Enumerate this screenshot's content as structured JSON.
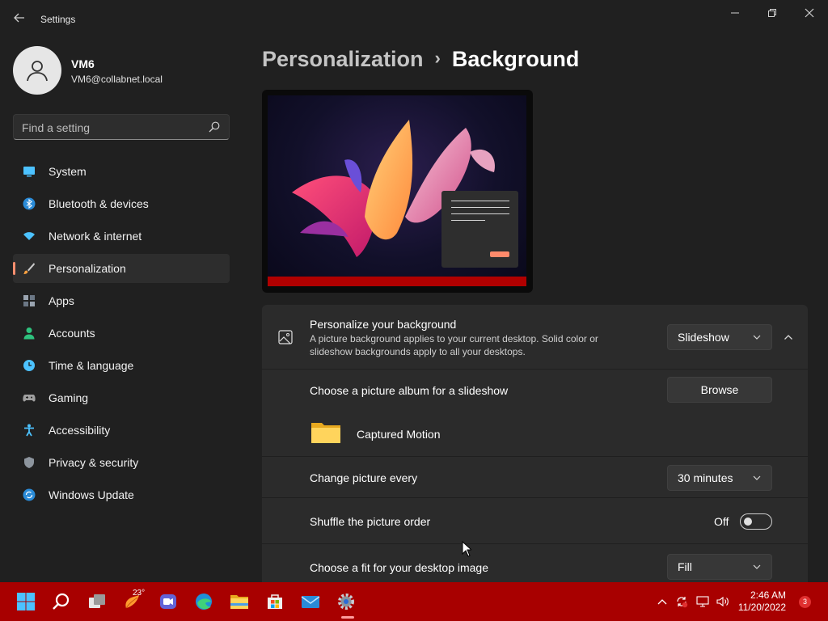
{
  "window": {
    "title": "Settings",
    "back_icon": "back-arrow-icon",
    "controls": {
      "minimize": "minimize-icon",
      "maximize": "restore-icon",
      "close": "close-icon"
    }
  },
  "user": {
    "name": "VM6",
    "email": "VM6@collabnet.local"
  },
  "search": {
    "placeholder": "Find a setting"
  },
  "sidebar": {
    "items": [
      {
        "label": "System",
        "icon": "monitor-icon",
        "color": "#4cc2ff"
      },
      {
        "label": "Bluetooth & devices",
        "icon": "bluetooth-icon",
        "color": "#4cc2ff"
      },
      {
        "label": "Network & internet",
        "icon": "wifi-icon",
        "color": "#4cc2ff"
      },
      {
        "label": "Personalization",
        "icon": "brush-icon",
        "color": "#f7a040",
        "active": true
      },
      {
        "label": "Apps",
        "icon": "apps-icon",
        "color": "#9aa4b0"
      },
      {
        "label": "Accounts",
        "icon": "person-icon",
        "color": "#2ec27e"
      },
      {
        "label": "Time & language",
        "icon": "clock-globe-icon",
        "color": "#4cc2ff"
      },
      {
        "label": "Gaming",
        "icon": "gamepad-icon",
        "color": "#a0a0a0"
      },
      {
        "label": "Accessibility",
        "icon": "accessibility-icon",
        "color": "#4cc2ff"
      },
      {
        "label": "Privacy & security",
        "icon": "shield-icon",
        "color": "#8d959e"
      },
      {
        "label": "Windows Update",
        "icon": "update-icon",
        "color": "#4cc2ff"
      }
    ]
  },
  "breadcrumb": {
    "parent": "Personalization",
    "separator": "›",
    "current": "Background"
  },
  "background_section": {
    "title": "Personalize your background",
    "description_line1": "A picture background applies to your current desktop. Solid color or",
    "description_line2": "slideshow backgrounds apply to all your desktops.",
    "type_value": "Slideshow",
    "album_label": "Choose a picture album for a slideshow",
    "browse_label": "Browse",
    "album_name": "Captured Motion",
    "interval_label": "Change picture every",
    "interval_value": "30 minutes",
    "shuffle_label": "Shuffle the picture order",
    "shuffle_state": "Off",
    "fit_label": "Choose a fit for your desktop image",
    "fit_value": "Fill"
  },
  "taskbar": {
    "color": "#a80000",
    "apps": [
      "windows-start-icon",
      "search-icon",
      "task-view-icon",
      "weather-icon",
      "teams-chat-icon",
      "edge-icon",
      "file-explorer-icon",
      "store-icon",
      "mail-icon",
      "settings-gear-icon"
    ],
    "weather_temp": "23°",
    "time": "2:46 AM",
    "date": "11/20/2022",
    "notification_count": "3"
  }
}
